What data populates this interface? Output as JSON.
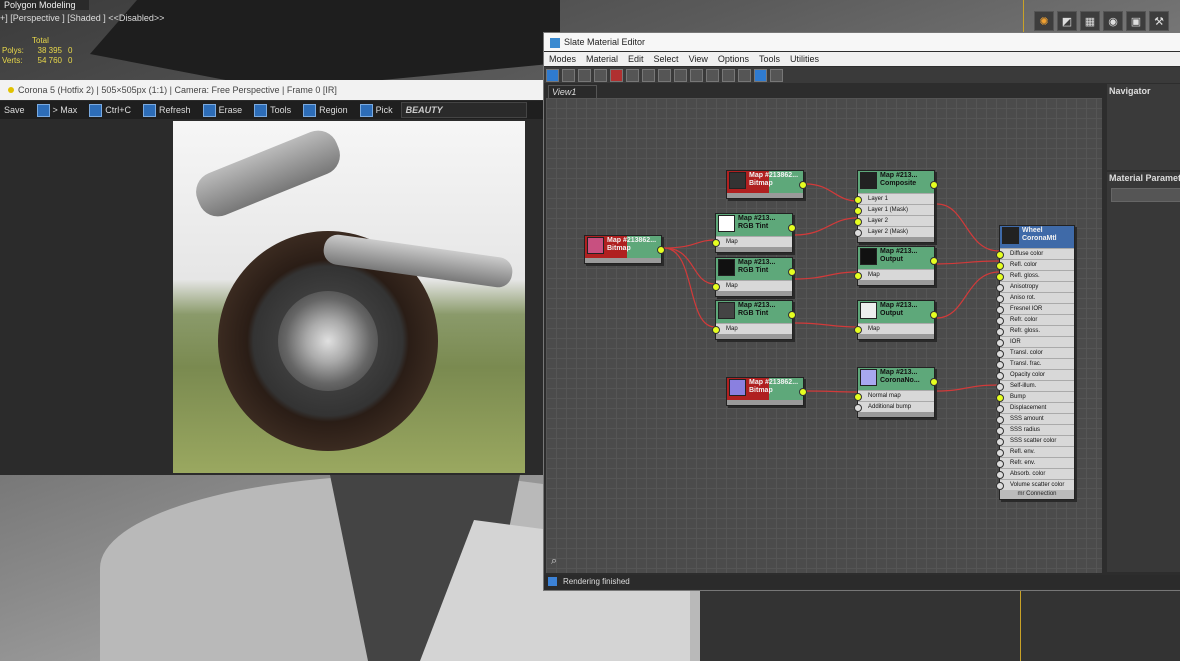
{
  "app": {
    "title": "Polygon Modeling"
  },
  "viewport": {
    "label": "+] [Perspective ] [Shaded ]  <<Disabled>>",
    "stats": {
      "header": "Total",
      "rows": [
        {
          "label": "Polys:",
          "total": "38 395",
          "sel": "0"
        },
        {
          "label": "Verts:",
          "total": "54 760",
          "sel": "0"
        }
      ]
    }
  },
  "corona": {
    "title": "Corona 5 (Hotfix 2) | 505×505px (1:1) | Camera: Free Perspective | Frame 0 [IR]",
    "toolbar": [
      "Save",
      "> Max",
      "Ctrl+C",
      "Refresh",
      "Erase",
      "Tools",
      "Region",
      "Pick"
    ],
    "channel": "BEAUTY"
  },
  "slate": {
    "title": "Slate Material Editor",
    "menu": [
      "Modes",
      "Material",
      "Edit",
      "Select",
      "View",
      "Options",
      "Tools",
      "Utilities"
    ],
    "view_tab": "View1",
    "navigator": "Navigator",
    "material_params": "Material Parameters",
    "status": "Rendering finished",
    "nodes": {
      "bitmap_top": {
        "title": "Map #213862...",
        "sub": "Bitmap"
      },
      "composite": {
        "title": "Map #213...",
        "sub": "Composite",
        "slots": [
          "Layer 1",
          "Layer 1 (Mask)",
          "Layer 2",
          "Layer 2 (Mask)"
        ]
      },
      "bitmap_left": {
        "title": "Map #213862...",
        "sub": "Bitmap"
      },
      "rgb1": {
        "title": "Map #213...",
        "sub": "RGB Tint",
        "slot": "Map"
      },
      "rgb2": {
        "title": "Map #213...",
        "sub": "RGB Tint",
        "slot": "Map"
      },
      "rgb3": {
        "title": "Map #213...",
        "sub": "RGB Tint",
        "slot": "Map"
      },
      "output1": {
        "title": "Map #213...",
        "sub": "Output",
        "slot": "Map"
      },
      "output2": {
        "title": "Map #213...",
        "sub": "Output",
        "slot": "Map"
      },
      "bitmap_bottom": {
        "title": "Map #213862...",
        "sub": "Bitmap"
      },
      "normal": {
        "title": "Map #213...",
        "sub": "CoronaNo...",
        "slots": [
          "Normal map",
          "Additional bump"
        ]
      },
      "material": {
        "title": "Wheel",
        "sub": "CoronaMtl",
        "slots": [
          "Diffuse color",
          "Refl. color",
          "Refl. gloss.",
          "Anisotropy",
          "Aniso rot.",
          "Fresnel IOR",
          "Refr. color",
          "Refr. gloss.",
          "IOR",
          "Transl. color",
          "Transl. frac.",
          "Opacity color",
          "Self-illum.",
          "Bump",
          "Displacement",
          "SSS amount",
          "SSS radius",
          "SSS scatter color",
          "Refl. env.",
          "Refr. env.",
          "Absorb. color",
          "Volume scatter color"
        ],
        "footer": "mr Connection"
      }
    }
  }
}
